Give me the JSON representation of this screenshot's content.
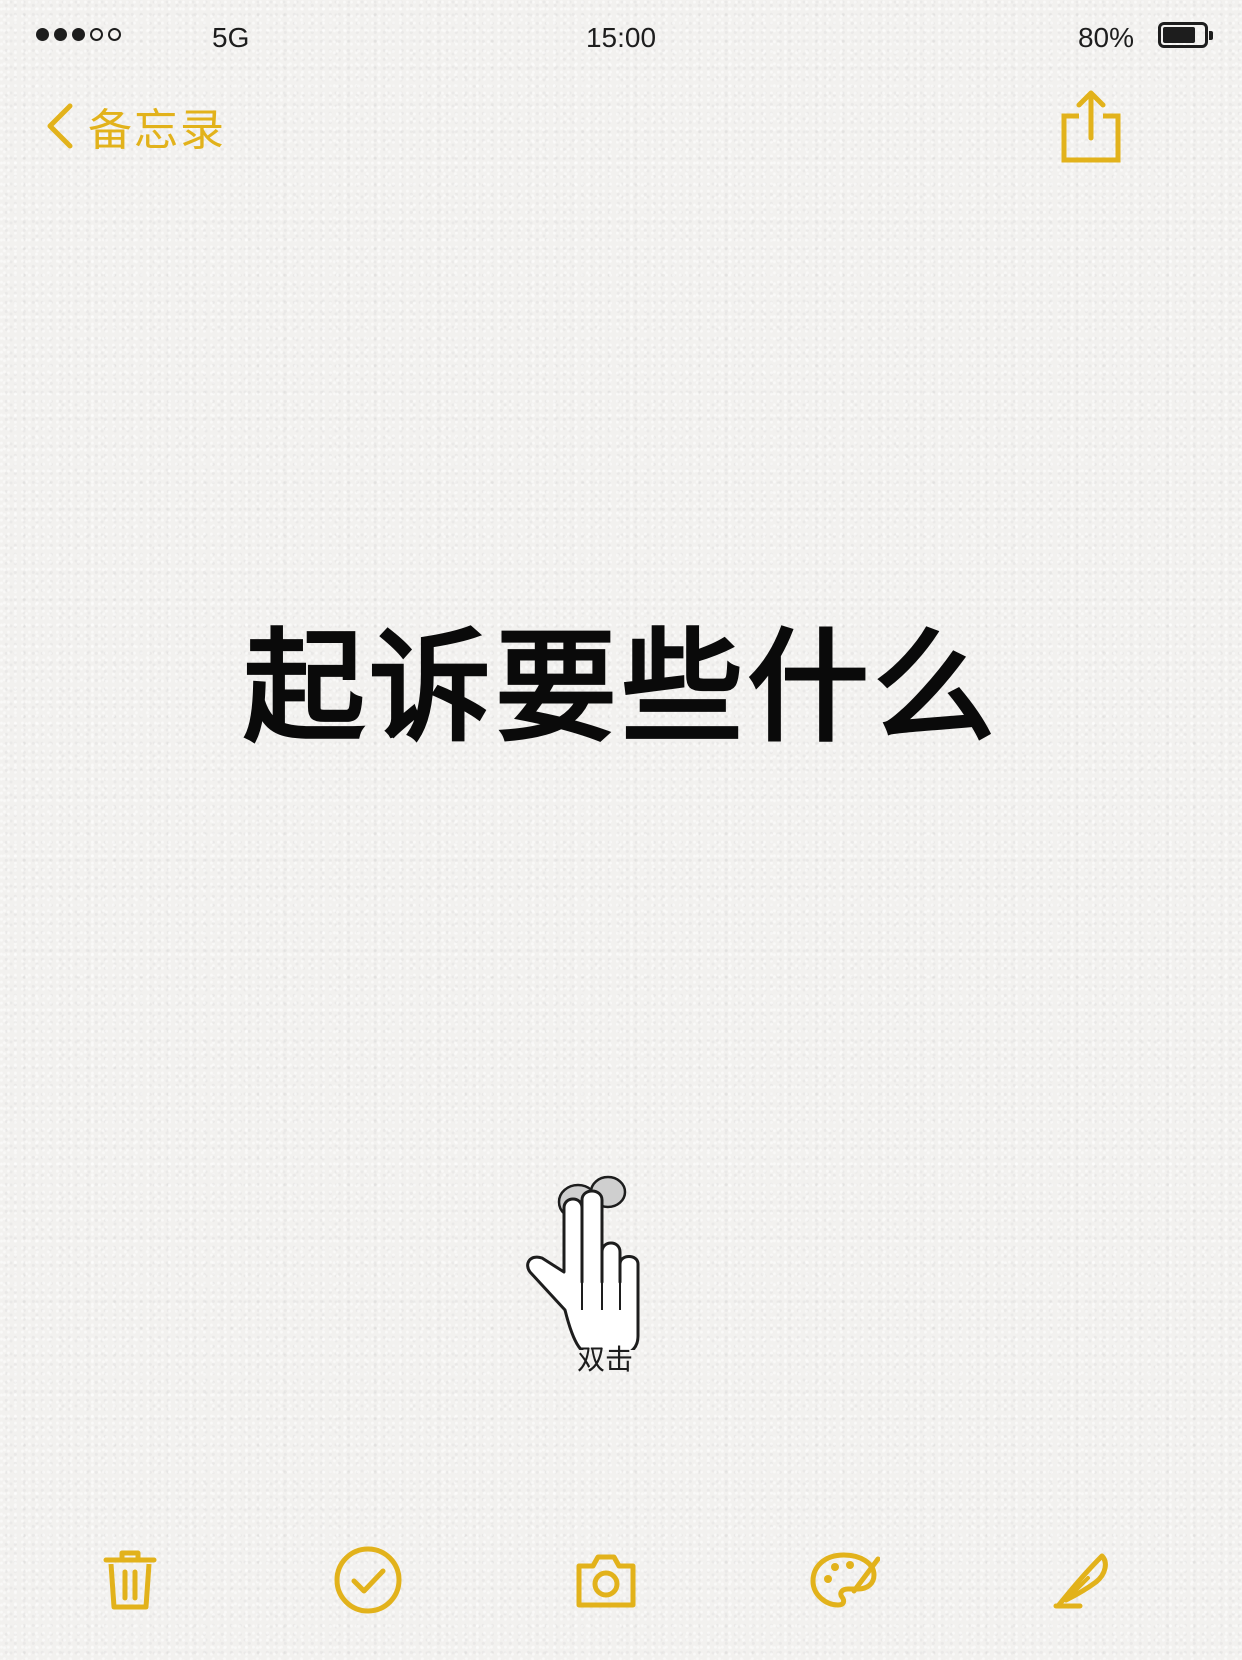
{
  "status_bar": {
    "carrier": "5G",
    "time": "15:00",
    "battery_percent": "80%",
    "battery_level": 0.8,
    "signal_bars_filled": 3,
    "signal_bars_total": 5
  },
  "nav": {
    "back_label": "备忘录",
    "back_icon": "chevron-left-icon",
    "share_icon": "share-icon"
  },
  "note": {
    "title": "起诉要些什么"
  },
  "gesture_hint": {
    "label": "双击",
    "icon": "two-finger-tap-hand-icon"
  },
  "toolbar": {
    "items": [
      {
        "icon": "trash-icon"
      },
      {
        "icon": "checklist-icon"
      },
      {
        "icon": "camera-icon"
      },
      {
        "icon": "palette-icon"
      },
      {
        "icon": "pen-icon"
      }
    ]
  },
  "colors": {
    "accent": "#e2b21b",
    "text": "#1d1d1d",
    "background": "#f2f1ef"
  }
}
